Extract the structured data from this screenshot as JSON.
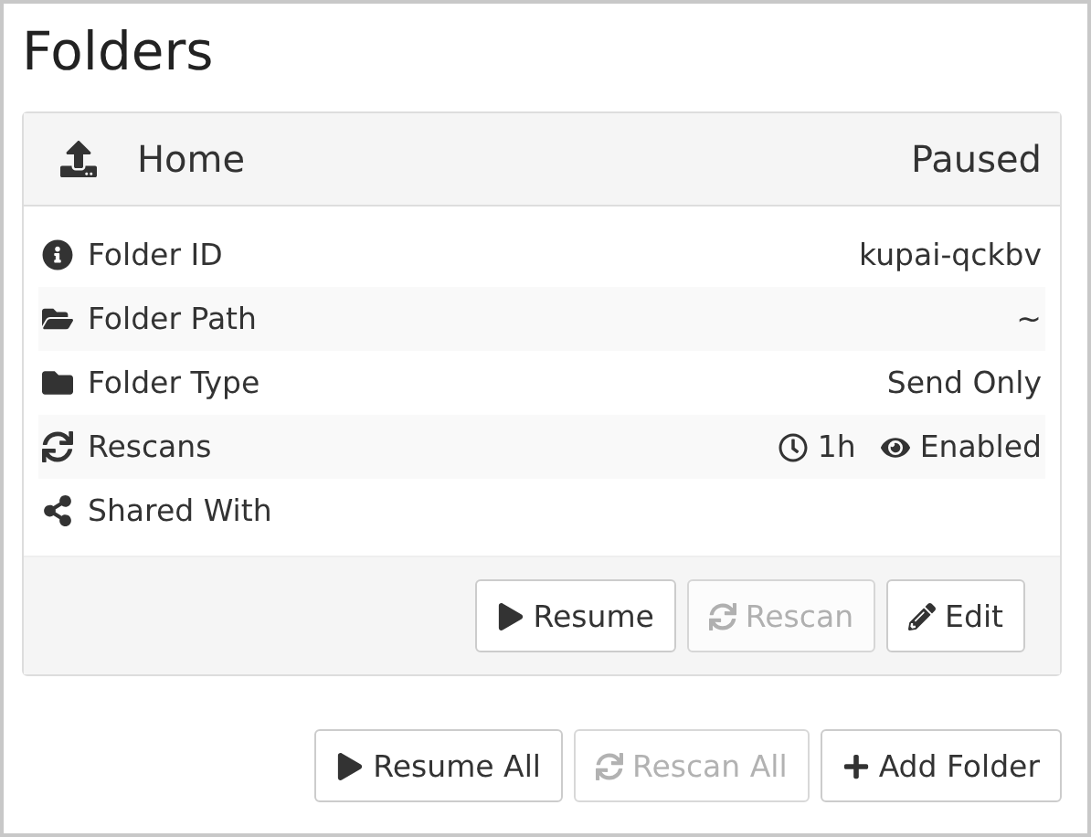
{
  "title": "Folders",
  "folder": {
    "name": "Home",
    "status": "Paused",
    "rows": [
      {
        "kind": "info",
        "label": "Folder ID",
        "values": [
          {
            "kind": "text",
            "text": "kupai-qckbv"
          }
        ]
      },
      {
        "kind": "folder-open",
        "label": "Folder Path",
        "values": [
          {
            "kind": "text",
            "text": "~"
          }
        ]
      },
      {
        "kind": "folder",
        "label": "Folder Type",
        "values": [
          {
            "kind": "text",
            "text": "Send Only"
          }
        ]
      },
      {
        "kind": "refresh",
        "label": "Rescans",
        "values": [
          {
            "kind": "clock",
            "text": "1h"
          },
          {
            "kind": "eye",
            "text": "Enabled"
          }
        ]
      },
      {
        "kind": "share",
        "label": "Shared With",
        "values": []
      }
    ],
    "buttons": [
      {
        "kind": "play",
        "label": "Resume",
        "disabled": false
      },
      {
        "kind": "refresh",
        "label": "Rescan",
        "disabled": true
      },
      {
        "kind": "pencil",
        "label": "Edit",
        "disabled": false
      }
    ]
  },
  "buttons": [
    {
      "kind": "play",
      "label": "Resume All",
      "disabled": false
    },
    {
      "kind": "refresh",
      "label": "Rescan All",
      "disabled": true
    },
    {
      "kind": "plus",
      "label": "Add Folder",
      "disabled": false
    }
  ]
}
